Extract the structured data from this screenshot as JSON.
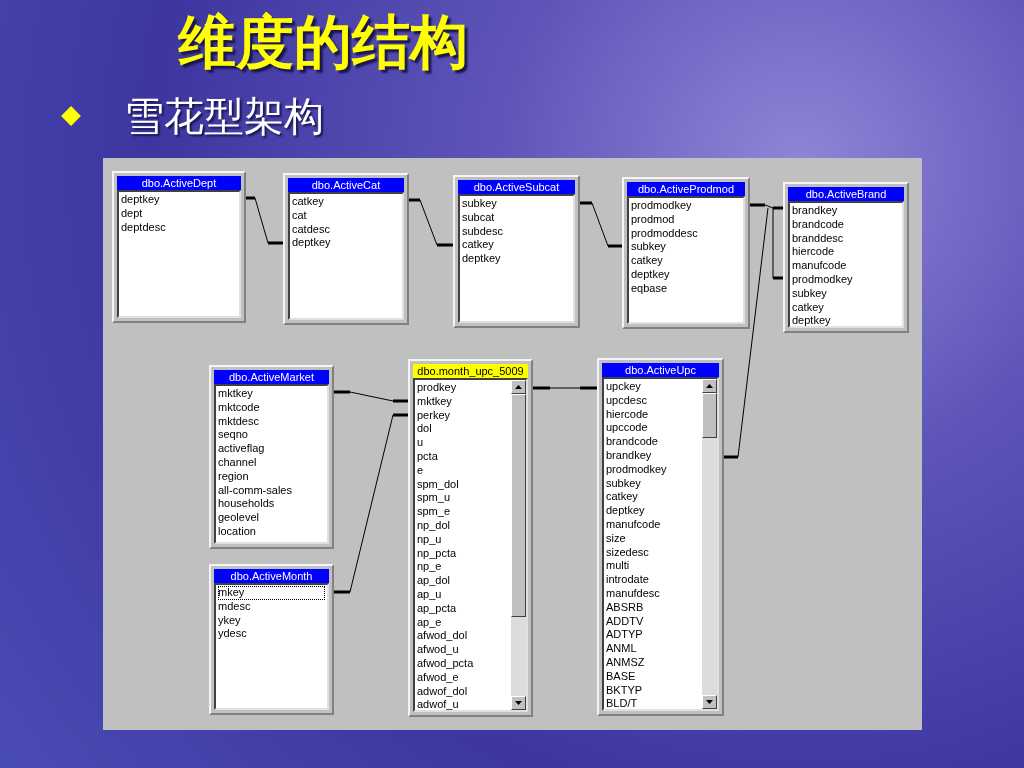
{
  "slide": {
    "title": "维度的结构",
    "bullets": [
      "雪花型架构"
    ]
  },
  "diagram": {
    "tables": [
      {
        "name": "dbo.ActiveDept",
        "selected": false,
        "scrollbar": false,
        "fields": [
          "deptkey",
          "dept",
          "deptdesc"
        ]
      },
      {
        "name": "dbo.ActiveCat",
        "selected": false,
        "scrollbar": false,
        "fields": [
          "catkey",
          "cat",
          "catdesc",
          "deptkey"
        ]
      },
      {
        "name": "dbo.ActiveSubcat",
        "selected": false,
        "scrollbar": false,
        "fields": [
          "subkey",
          "subcat",
          "subdesc",
          "catkey",
          "deptkey"
        ]
      },
      {
        "name": "dbo.ActiveProdmod",
        "selected": false,
        "scrollbar": false,
        "fields": [
          "prodmodkey",
          "prodmod",
          "prodmoddesc",
          "subkey",
          "catkey",
          "deptkey",
          "eqbase"
        ]
      },
      {
        "name": "dbo.ActiveBrand",
        "selected": false,
        "scrollbar": false,
        "fields": [
          "brandkey",
          "brandcode",
          "branddesc",
          "hiercode",
          "manufcode",
          "prodmodkey",
          "subkey",
          "catkey",
          "deptkey"
        ]
      },
      {
        "name": "dbo.ActiveMarket",
        "selected": false,
        "scrollbar": false,
        "fields": [
          "mktkey",
          "mktcode",
          "mktdesc",
          "seqno",
          "activeflag",
          "channel",
          "region",
          "all-comm-sales",
          "households",
          "geolevel",
          "location"
        ]
      },
      {
        "name": "dbo.ActiveMonth",
        "selected": false,
        "scrollbar": false,
        "fields": [
          {
            "name": "mkey",
            "focused": true
          },
          {
            "name": "mdesc",
            "focused": false
          },
          {
            "name": "ykey",
            "focused": false
          },
          {
            "name": "ydesc",
            "focused": false
          }
        ]
      },
      {
        "name": "dbo.month_upc_5009",
        "selected": true,
        "scrollbar": true,
        "fields": [
          "prodkey",
          "mktkey",
          "perkey",
          "dol",
          "u",
          "pcta",
          "e",
          "spm_dol",
          "spm_u",
          "spm_e",
          "np_dol",
          "np_u",
          "np_pcta",
          "np_e",
          "ap_dol",
          "ap_u",
          "ap_pcta",
          "ap_e",
          "afwod_dol",
          "afwod_u",
          "afwod_pcta",
          "afwod_e",
          "adwof_dol",
          "adwof_u"
        ]
      },
      {
        "name": "dbo.ActiveUpc",
        "selected": false,
        "scrollbar": true,
        "fields": [
          "upckey",
          "upcdesc",
          "hiercode",
          "upccode",
          "brandcode",
          "brandkey",
          "prodmodkey",
          "subkey",
          "catkey",
          "deptkey",
          "manufcode",
          "size",
          "sizedesc",
          "multi",
          "introdate",
          "manufdesc",
          "ABSRB",
          "ADDTV",
          "ADTYP",
          "ANML",
          "ANMSZ",
          "BASE",
          "BKTYP",
          "BLD/T"
        ]
      }
    ]
  }
}
